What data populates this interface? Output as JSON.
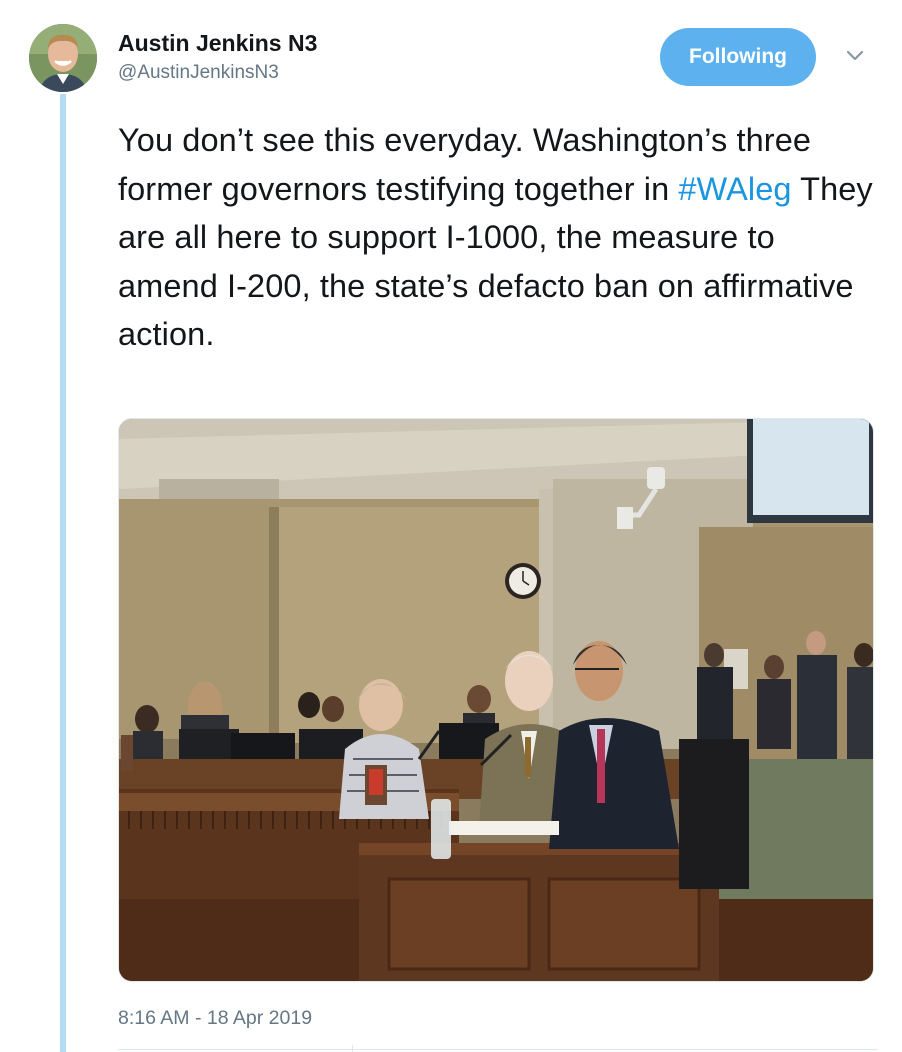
{
  "tweet": {
    "author_name": "Austin Jenkins N3",
    "author_handle": "@AustinJenkinsN3",
    "follow_label": "Following",
    "text_part1": "You don’t see this everyday. Washington’s three former governors testifying together in ",
    "hashtag": "#WAleg",
    "text_part2": " They are all here to support I-1000, the measure to amend I-200, the state’s defacto ban on affirmative action.",
    "timestamp": "8:16 AM - 18 Apr 2019",
    "icons": {
      "caret": "chevron-down-icon",
      "avatar": "avatar"
    },
    "colors": {
      "accent": "#5cb1ee",
      "hashtag": "#1b95e0",
      "thread_line": "#b3dcf5",
      "secondary_text": "#657786"
    }
  }
}
